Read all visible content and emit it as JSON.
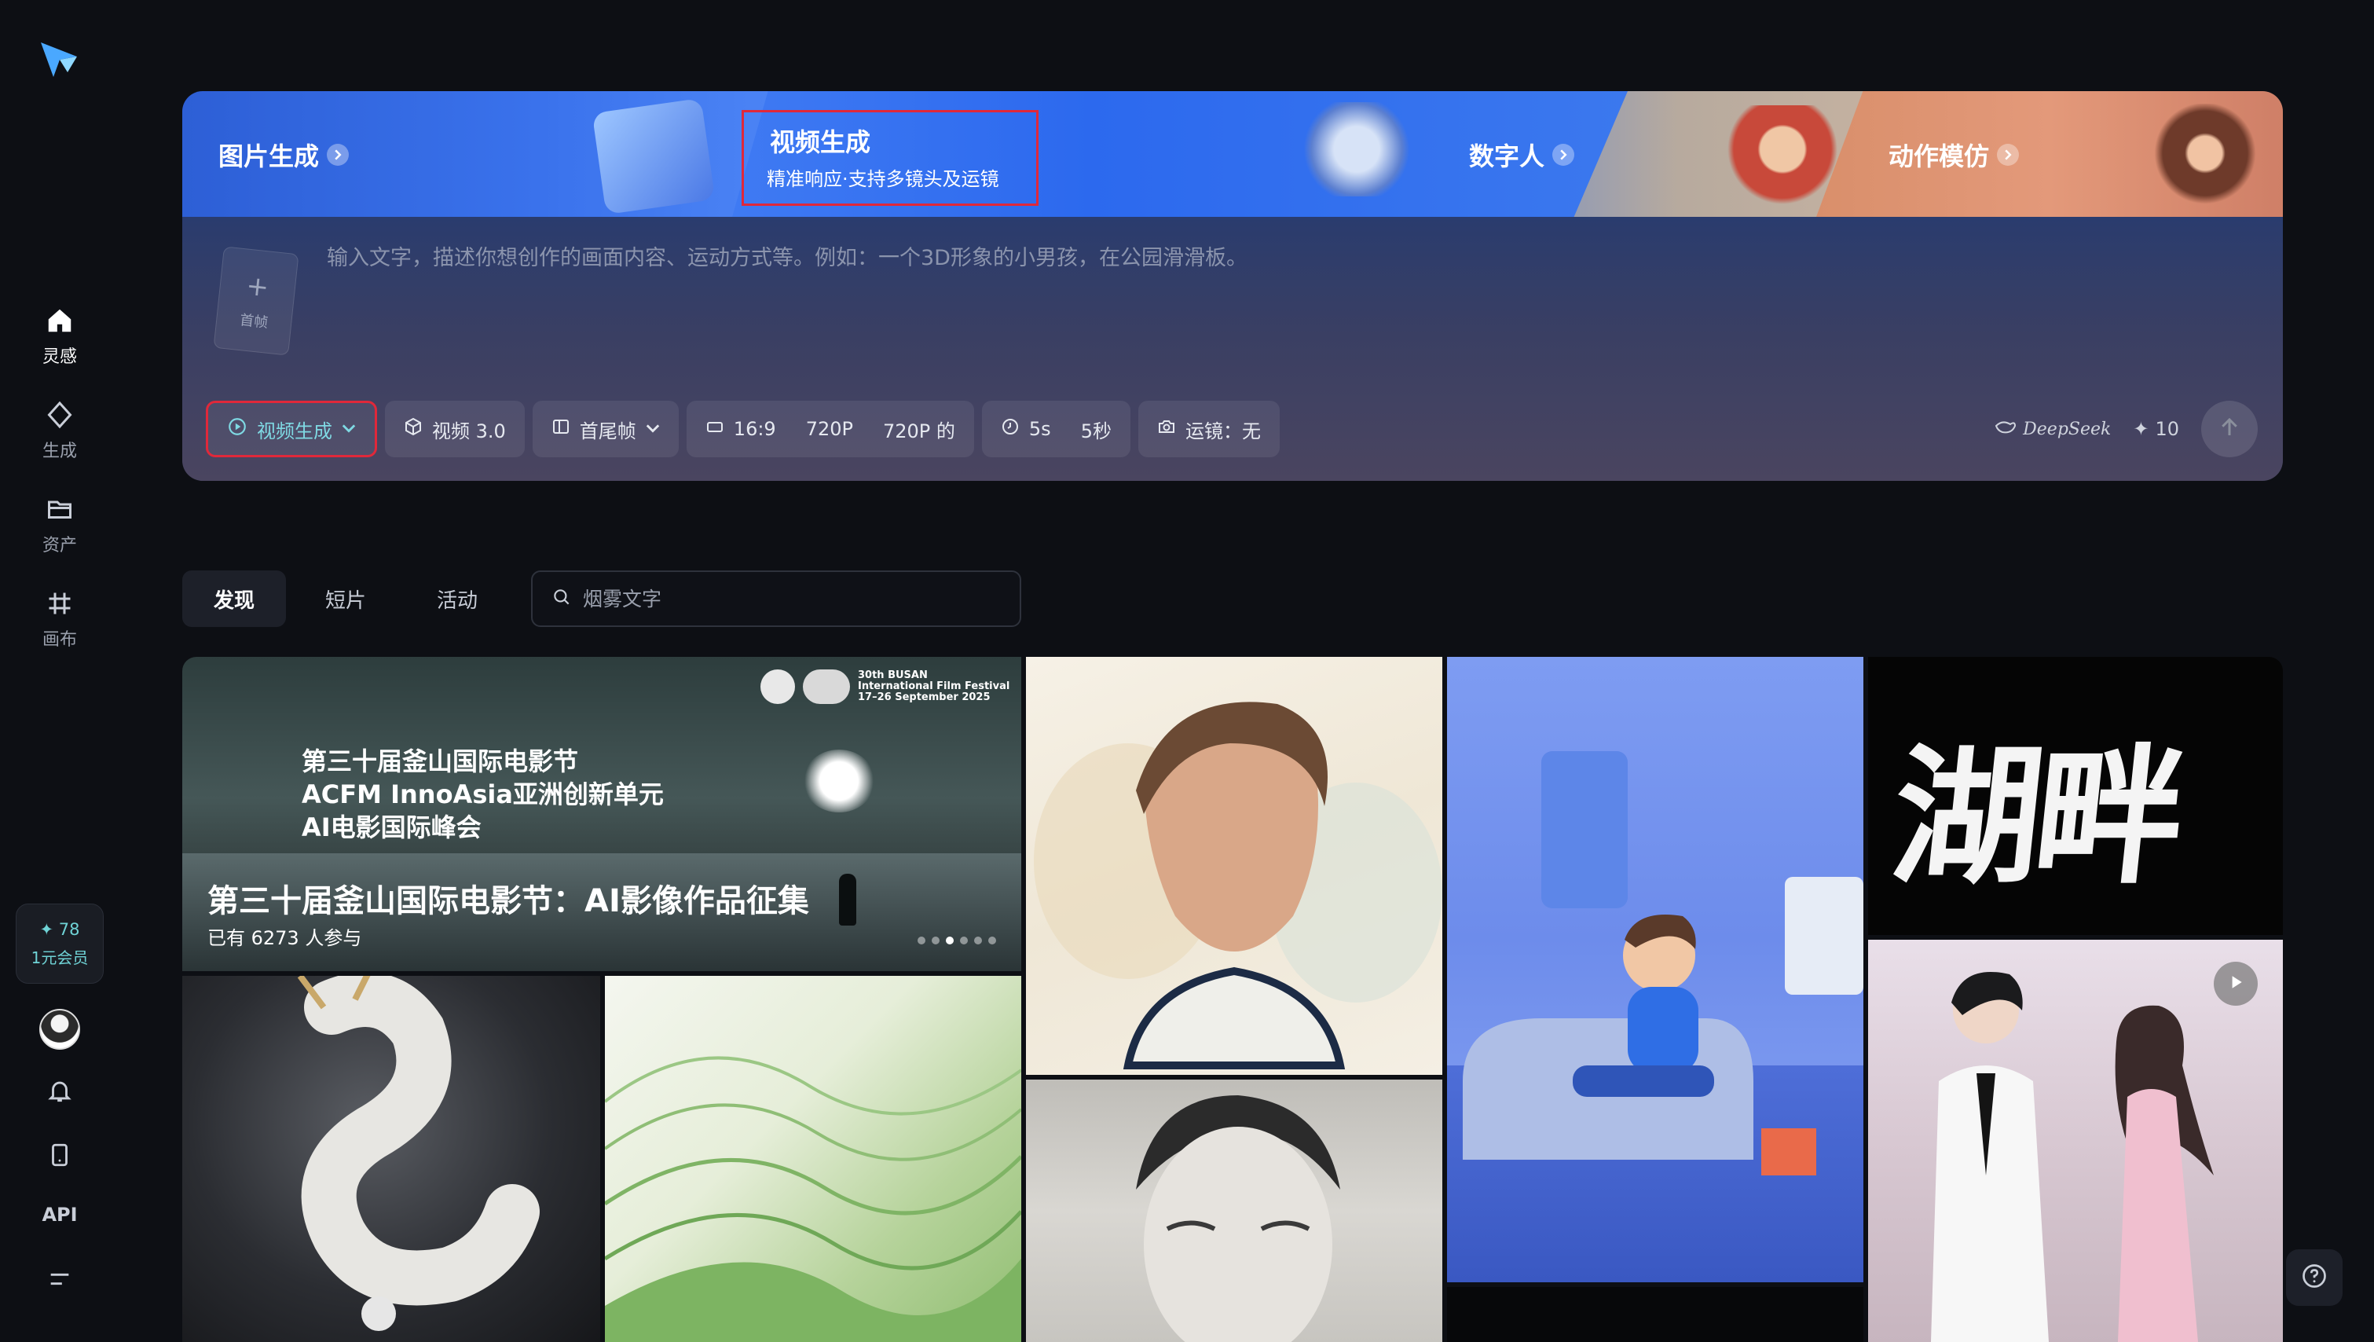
{
  "sidebar": {
    "items": [
      {
        "label": "灵感",
        "icon": "home-icon"
      },
      {
        "label": "生成",
        "icon": "diamond-icon"
      },
      {
        "label": "资产",
        "icon": "folder-icon"
      },
      {
        "label": "画布",
        "icon": "canvas-icon"
      }
    ],
    "credits": "✦ 78",
    "membership": "1元会员",
    "api_label": "API"
  },
  "hero": {
    "tabs": [
      {
        "label": "图片生成"
      },
      {
        "label": "视频生成",
        "subtitle": "精准响应·支持多镜头及运镜"
      },
      {
        "label": "数字人"
      },
      {
        "label": "动作模仿"
      }
    ],
    "upload_label": "首帧",
    "prompt_placeholder": "输入文字，描述你想创作的画面内容、运动方式等。例如：一个3D形象的小男孩，在公园滑滑板。",
    "toolbar": {
      "mode": "视频生成",
      "model": "视频 3.0",
      "frame": "首尾帧",
      "ratio": "16:9",
      "resolution": "720P",
      "resolution_text": "720P 的",
      "duration": "5s",
      "duration_text": "5秒",
      "camera": "运镜：无"
    },
    "deepseek_label": "DeepSeek",
    "cost": "10"
  },
  "feed": {
    "tabs": [
      "发现",
      "短片",
      "活动"
    ],
    "search_placeholder": "烟雾文字"
  },
  "banner": {
    "festival_text": [
      "30th BUSAN",
      "International Film Festival",
      "17–26 September 2025"
    ],
    "lines": [
      "第三十届釜山国际电影节",
      "ACFM InnoAsia亚洲创新单元",
      "AI电影国际峰会"
    ],
    "title": "第三十届釜山国际电影节：AI影像作品征集",
    "participants": "已有 6273 人参与"
  },
  "gallery": {
    "calligraphy_text": "湖畔"
  },
  "colors": {
    "accent": "#7fd9e3",
    "highlight_border": "#e0283a",
    "background": "#0d0f14"
  }
}
